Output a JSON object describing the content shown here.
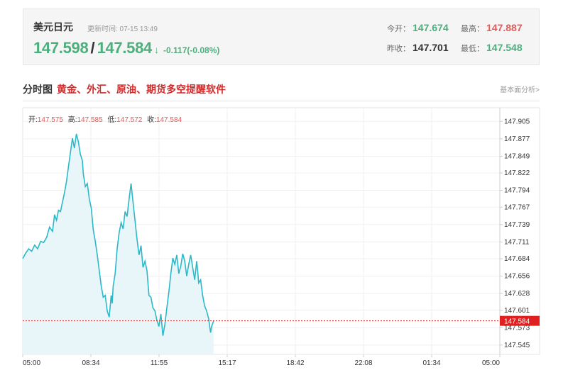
{
  "quote": {
    "name": "美元日元",
    "update_time": "更新时间: 07-15 13:49",
    "bid": "147.598",
    "ask": "147.584",
    "arrow": "↓",
    "change": "-0.117(-0.08%)",
    "open_label": "今开：",
    "open": "147.674",
    "high_label": "最高：",
    "high": "147.887",
    "prev_close_label": "昨收：",
    "prev_close": "147.701",
    "low_label": "最低：",
    "low": "147.548"
  },
  "section": {
    "title": "分时图",
    "link": "黄金、外汇、原油、期货多空提醒软件",
    "right_link": "基本面分析>"
  },
  "colors": {
    "up": "#e65a5a",
    "down": "#4caf7d",
    "line": "#2bb9c9",
    "fill": "#e8f6f9",
    "marker": "#e02020"
  },
  "chart_data": {
    "type": "area",
    "ohlc": [
      {
        "label": "开:",
        "value": "147.575"
      },
      {
        "label": "高:",
        "value": "147.585"
      },
      {
        "label": "低:",
        "value": "147.572"
      },
      {
        "label": "收:",
        "value": "147.584"
      }
    ],
    "x_ticks": [
      "05:00",
      "08:34",
      "11:55",
      "15:17",
      "18:42",
      "22:08",
      "01:34",
      "05:00"
    ],
    "y_ticks": [
      "147.905",
      "147.877",
      "147.849",
      "147.822",
      "147.794",
      "147.767",
      "147.739",
      "147.711",
      "147.684",
      "147.656",
      "147.628",
      "147.601",
      "147.573",
      "147.545"
    ],
    "ylim": [
      147.53,
      147.927
    ],
    "x_hours": [
      0,
      24
    ],
    "current_price": 147.584,
    "current_label": "147.584",
    "series": [
      {
        "values": [
          [
            0.0,
            147.684
          ],
          [
            0.15,
            147.693
          ],
          [
            0.3,
            147.7
          ],
          [
            0.45,
            147.696
          ],
          [
            0.6,
            147.706
          ],
          [
            0.75,
            147.7
          ],
          [
            0.9,
            147.712
          ],
          [
            1.05,
            147.71
          ],
          [
            1.2,
            147.718
          ],
          [
            1.35,
            147.735
          ],
          [
            1.5,
            147.728
          ],
          [
            1.6,
            147.755
          ],
          [
            1.7,
            147.746
          ],
          [
            1.8,
            147.762
          ],
          [
            1.9,
            147.76
          ],
          [
            2.0,
            147.775
          ],
          [
            2.1,
            147.79
          ],
          [
            2.2,
            147.808
          ],
          [
            2.3,
            147.832
          ],
          [
            2.4,
            147.855
          ],
          [
            2.5,
            147.878
          ],
          [
            2.6,
            147.862
          ],
          [
            2.7,
            147.885
          ],
          [
            2.8,
            147.872
          ],
          [
            2.9,
            147.852
          ],
          [
            3.0,
            147.842
          ],
          [
            3.05,
            147.82
          ],
          [
            3.15,
            147.8
          ],
          [
            3.25,
            147.805
          ],
          [
            3.35,
            147.78
          ],
          [
            3.45,
            147.765
          ],
          [
            3.55,
            147.73
          ],
          [
            3.65,
            147.712
          ],
          [
            3.75,
            147.69
          ],
          [
            3.85,
            147.665
          ],
          [
            3.95,
            147.64
          ],
          [
            4.05,
            147.622
          ],
          [
            4.15,
            147.625
          ],
          [
            4.25,
            147.6
          ],
          [
            4.35,
            147.59
          ],
          [
            4.45,
            147.625
          ],
          [
            4.5,
            147.612
          ],
          [
            4.55,
            147.64
          ],
          [
            4.65,
            147.66
          ],
          [
            4.75,
            147.7
          ],
          [
            4.85,
            147.726
          ],
          [
            4.95,
            147.742
          ],
          [
            5.05,
            147.732
          ],
          [
            5.15,
            147.76
          ],
          [
            5.25,
            147.752
          ],
          [
            5.35,
            147.78
          ],
          [
            5.45,
            147.805
          ],
          [
            5.55,
            147.775
          ],
          [
            5.65,
            147.745
          ],
          [
            5.75,
            147.715
          ],
          [
            5.85,
            147.69
          ],
          [
            5.95,
            147.705
          ],
          [
            6.05,
            147.67
          ],
          [
            6.15,
            147.68
          ],
          [
            6.25,
            147.665
          ],
          [
            6.35,
            147.625
          ],
          [
            6.45,
            147.622
          ],
          [
            6.55,
            147.605
          ],
          [
            6.65,
            147.6
          ],
          [
            6.75,
            147.585
          ],
          [
            6.85,
            147.575
          ],
          [
            6.95,
            147.595
          ],
          [
            7.05,
            147.56
          ],
          [
            7.15,
            147.578
          ],
          [
            7.25,
            147.605
          ],
          [
            7.35,
            147.63
          ],
          [
            7.45,
            147.66
          ],
          [
            7.55,
            147.685
          ],
          [
            7.65,
            147.675
          ],
          [
            7.75,
            147.69
          ],
          [
            7.85,
            147.66
          ],
          [
            7.95,
            147.672
          ],
          [
            8.05,
            147.692
          ],
          [
            8.15,
            147.68
          ],
          [
            8.25,
            147.656
          ],
          [
            8.35,
            147.675
          ],
          [
            8.45,
            147.69
          ],
          [
            8.55,
            147.67
          ],
          [
            8.65,
            147.65
          ],
          [
            8.75,
            147.68
          ],
          [
            8.8,
            147.665
          ],
          [
            8.85,
            147.645
          ],
          [
            8.95,
            147.65
          ],
          [
            9.05,
            147.625
          ],
          [
            9.15,
            147.608
          ],
          [
            9.25,
            147.6
          ],
          [
            9.35,
            147.588
          ],
          [
            9.45,
            147.565
          ],
          [
            9.5,
            147.575
          ],
          [
            9.6,
            147.584
          ]
        ]
      }
    ]
  }
}
